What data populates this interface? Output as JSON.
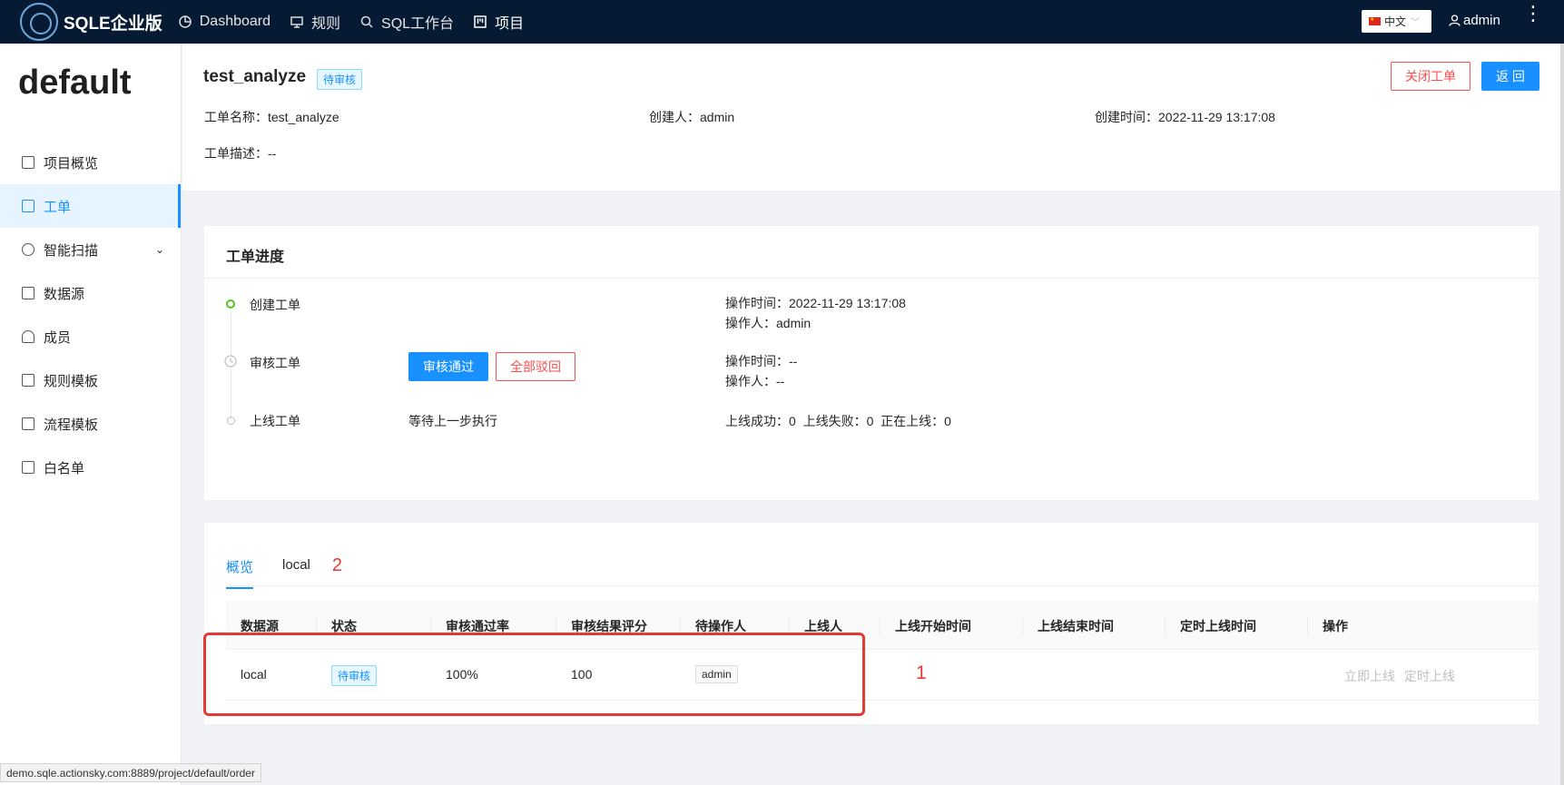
{
  "app": {
    "logo_text": "SQLE企业版",
    "nav": [
      {
        "label": "Dashboard",
        "icon": "pie-chart-icon"
      },
      {
        "label": "规则",
        "icon": "monitor-icon"
      },
      {
        "label": "SQL工作台",
        "icon": "search-icon"
      },
      {
        "label": "项目",
        "icon": "project-icon"
      }
    ],
    "language": "中文",
    "username": "admin"
  },
  "sidebar": {
    "project_name": "default",
    "items": [
      {
        "label": "项目概览"
      },
      {
        "label": "工单"
      },
      {
        "label": "智能扫描"
      },
      {
        "label": "数据源"
      },
      {
        "label": "成员"
      },
      {
        "label": "规则模板"
      },
      {
        "label": "流程模板"
      },
      {
        "label": "白名单"
      }
    ]
  },
  "order": {
    "name": "test_analyze",
    "status": "待审核",
    "close_label": "关闭工单",
    "back_label": "返 回",
    "name_field": "工单名称：test_analyze",
    "creator_field": "创建人：admin",
    "created_field": "创建时间：2022-11-29 13:17:08",
    "desc_field": "工单描述：--"
  },
  "progress": {
    "title": "工单进度",
    "steps": [
      {
        "label": "创建工单",
        "time": "操作时间：2022-11-29 13:17:08",
        "operator": "操作人：admin"
      },
      {
        "label": "审核工单",
        "approve_label": "审核通过",
        "reject_label": "全部驳回",
        "time": "操作时间：--",
        "operator": "操作人：--"
      },
      {
        "label": "上线工单",
        "waiting": "等待上一步执行",
        "stats": "上线成功：0  上线失败：0  正在上线：0"
      }
    ]
  },
  "tabs": {
    "items": [
      "概览",
      "local"
    ],
    "count": "2"
  },
  "table": {
    "headers": [
      "数据源",
      "状态",
      "审核通过率",
      "审核结果评分",
      "待操作人",
      "上线人",
      "上线开始时间",
      "上线结束时间",
      "定时上线时间",
      "操作"
    ],
    "row": {
      "datasource": "local",
      "status": "待审核",
      "pass_rate": "100%",
      "score": "100",
      "assignee": "admin",
      "action_now": "立即上线",
      "action_scheduled": "定时上线"
    }
  },
  "annotation": {
    "number": "1"
  },
  "statusbar": {
    "url": "demo.sqle.actionsky.com:8889/project/default/order"
  },
  "colors": {
    "primary": "#1890ff",
    "danger": "#ff4d4f",
    "topbar": "#061b33",
    "annotation": "#e53935"
  }
}
